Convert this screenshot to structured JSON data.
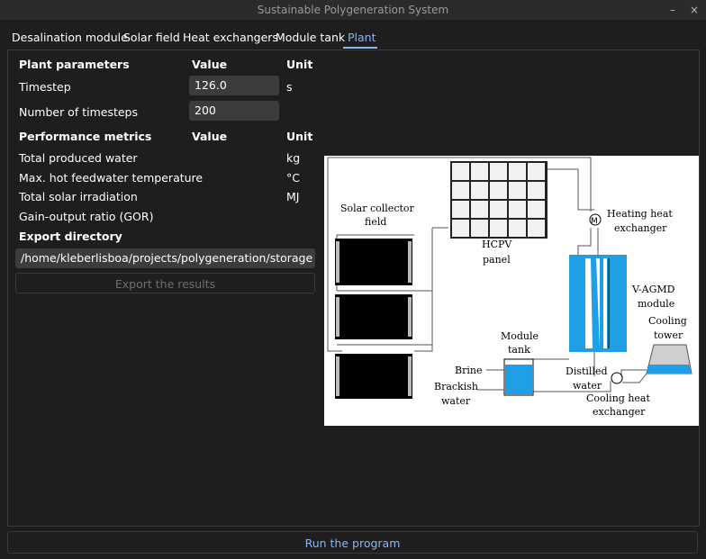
{
  "window": {
    "title": "Sustainable Polygeneration System",
    "minimize": "–",
    "close": "×"
  },
  "tabs": [
    {
      "label": "Desalination module"
    },
    {
      "label": "Solar field"
    },
    {
      "label": "Heat exchangers"
    },
    {
      "label": "Module tank"
    },
    {
      "label": "Plant",
      "active": true
    }
  ],
  "plant_parameters": {
    "header": {
      "name": "Plant parameters",
      "value": "Value",
      "unit": "Unit"
    },
    "rows": [
      {
        "label": "Timestep",
        "value": "126.0",
        "unit": "s"
      },
      {
        "label": "Number of timesteps",
        "value": "200",
        "unit": ""
      }
    ]
  },
  "performance_metrics": {
    "header": {
      "name": "Performance metrics",
      "value": "Value",
      "unit": "Unit"
    },
    "rows": [
      {
        "label": "Total produced water",
        "unit": "kg"
      },
      {
        "label": "Max. hot feedwater temperature",
        "unit": "°C"
      },
      {
        "label": "Total solar irradiation",
        "unit": "MJ"
      },
      {
        "label": "Gain-output ratio (GOR)",
        "unit": ""
      }
    ]
  },
  "export": {
    "label": "Export directory",
    "path": "/home/kleberlisboa/projects/polygeneration/storage",
    "button": "Export the results"
  },
  "run_button": "Run the program",
  "diagram_labels": {
    "solar_collector": "Solar collector",
    "field": "field",
    "hcpv": "HCPV",
    "panel": "panel",
    "heating": "Heating heat",
    "heat_exchanger": "exchanger",
    "vagmd": "V-AGMD",
    "module": "module",
    "cooling": "Cooling",
    "tower": "tower",
    "module_tank_1": "Module",
    "module_tank_2": "tank",
    "brine": "Brine",
    "brackish": "Brackish",
    "water": "water",
    "distilled": "Distilled",
    "distilled_water": "water",
    "cooling_heat": "Cooling heat",
    "cooling_exchanger": "exchanger"
  },
  "colors": {
    "accent": "#8ab4f8",
    "water_blue": "#1e9fe6"
  }
}
